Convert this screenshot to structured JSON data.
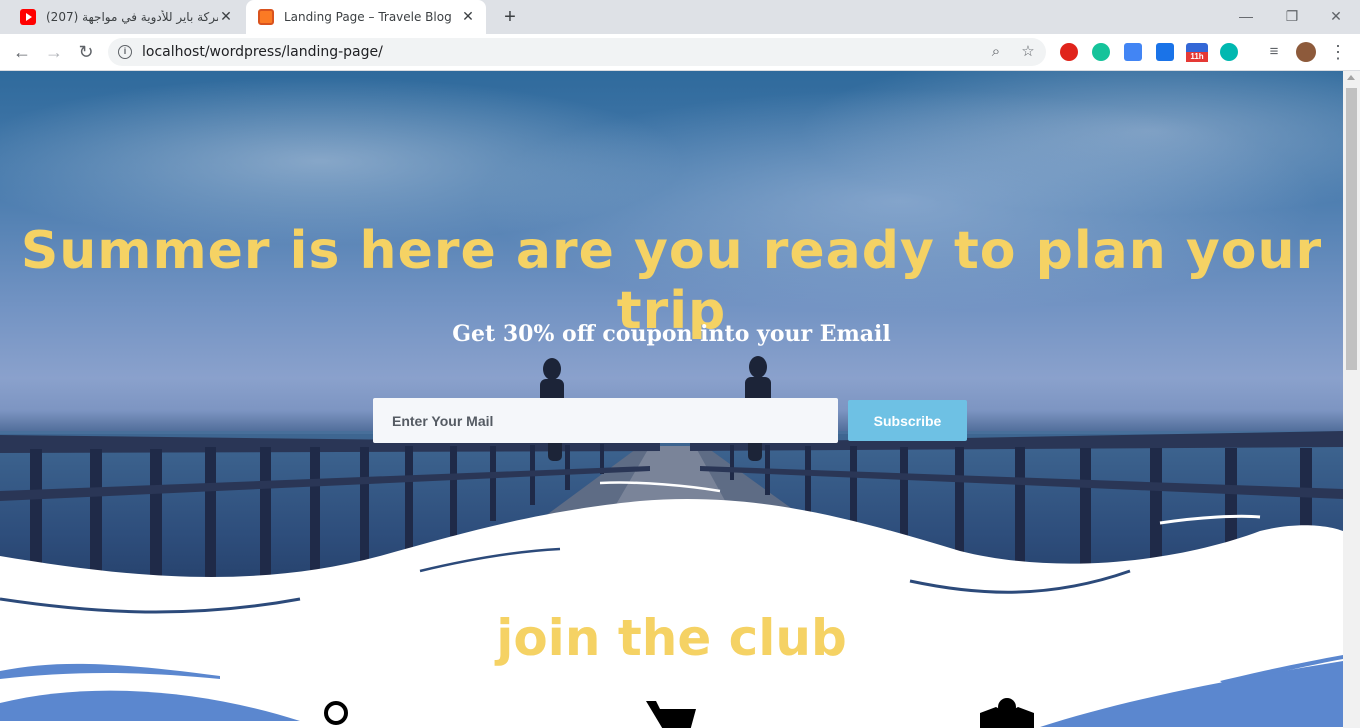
{
  "browser": {
    "tabs": [
      {
        "title": "(207) شركة باير للأدوية في مواجهة",
        "icon": "youtube-icon",
        "active": false
      },
      {
        "title": "Landing Page – Travele Blog",
        "icon": "xampp-icon",
        "active": true
      }
    ],
    "url": "localhost/wordpress/landing-page/",
    "extension_badge": "11h"
  },
  "hero": {
    "headline": "Summer is here are you ready to plan your trip",
    "subheadline": "Get 30% off coupon into your Email",
    "email_placeholder": "Enter Your Mail",
    "subscribe_label": "Subscribe"
  },
  "club": {
    "title": "join the club",
    "icons": [
      "location-pin-icon",
      "cart-icon",
      "map-icon"
    ]
  },
  "colors": {
    "accent_yellow": "#f5d264",
    "button_blue": "#6ec1e4",
    "wave_blue": "#5b87cf"
  }
}
